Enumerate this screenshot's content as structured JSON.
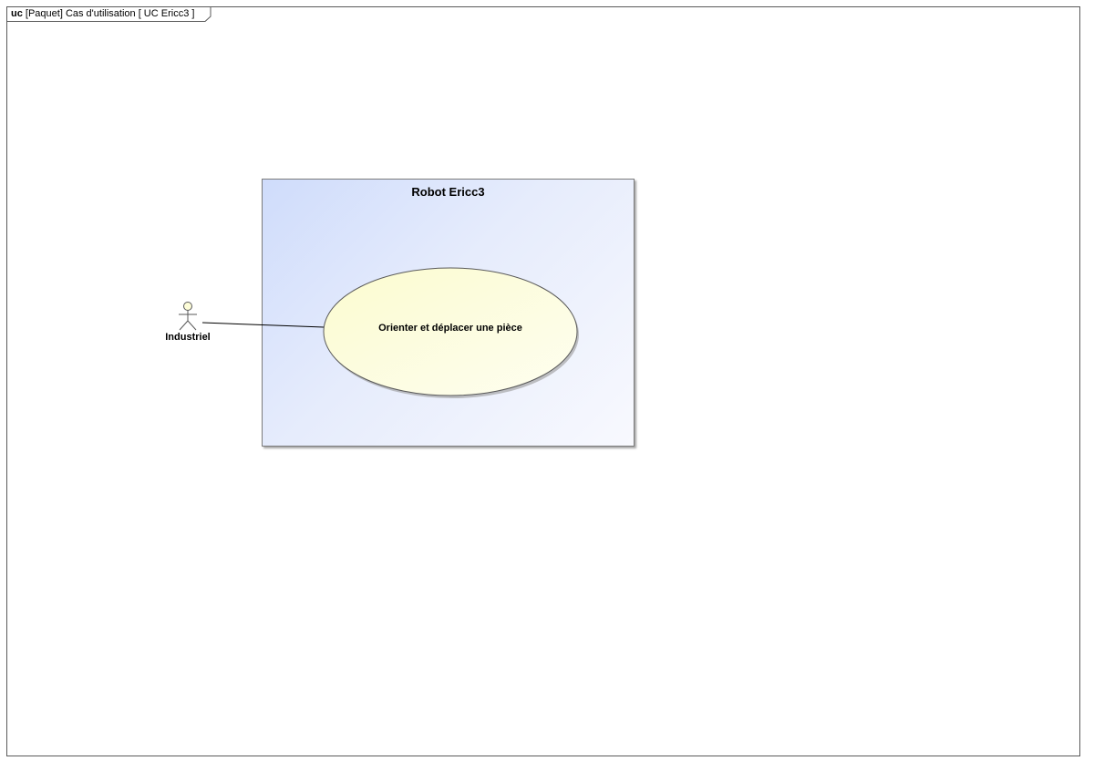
{
  "frame": {
    "keyword": "uc",
    "title": "[Paquet] Cas d'utilisation [ UC Ericc3 ]"
  },
  "system": {
    "name": "Robot Ericc3"
  },
  "actor": {
    "name": "Industriel"
  },
  "use_case": {
    "name": "Orienter et déplacer une pièce"
  },
  "colors": {
    "system_fill_start": "#cfdcfb",
    "system_fill_end": "#f8f9fe",
    "use_case_fill": "#fdfdd8",
    "actor_fill": "#fdfdd8",
    "stroke": "#5a5a5a"
  }
}
